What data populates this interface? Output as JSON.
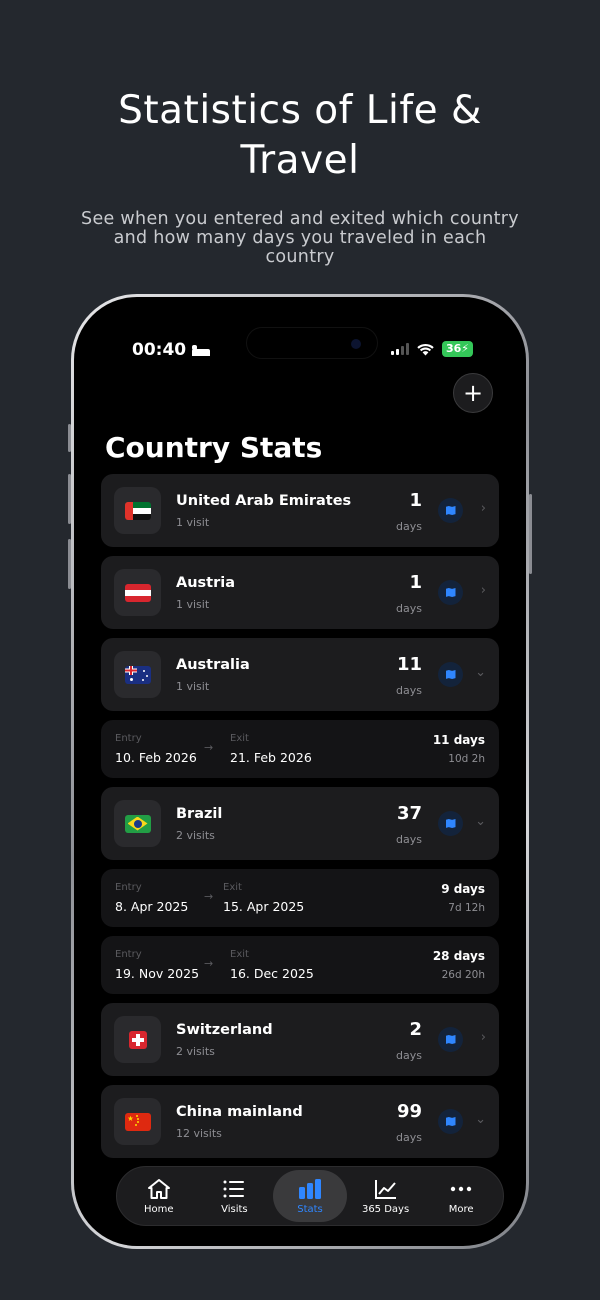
{
  "hero": {
    "title_line1": "Statistics of Life &",
    "title_line2": "Travel",
    "subtitle": "See when you entered and exited which country and how many days you traveled in each country"
  },
  "status_bar": {
    "time": "00:40",
    "battery": "36"
  },
  "header": {
    "add_label": "+",
    "title": "Country Stats"
  },
  "countries": [
    {
      "name": "United Arab Emirates",
      "visits": "1 visit",
      "days": "1",
      "days_label": "days",
      "flag": "uae-flag-icon"
    },
    {
      "name": "Austria",
      "visits": "1 visit",
      "days": "1",
      "days_label": "days",
      "flag": "austria-flag-icon"
    },
    {
      "name": "Australia",
      "visits": "1 visit",
      "days": "11",
      "days_label": "days",
      "flag": "australia-flag-icon"
    },
    {
      "name": "Brazil",
      "visits": "2 visits",
      "days": "37",
      "days_label": "days",
      "flag": "brazil-flag-icon"
    },
    {
      "name": "Switzerland",
      "visits": "2 visits",
      "days": "2",
      "days_label": "days",
      "flag": "switzerland-flag-icon"
    },
    {
      "name": "China mainland",
      "visits": "12 visits",
      "days": "99",
      "days_label": "days",
      "flag": "china-flag-icon"
    }
  ],
  "periods": [
    {
      "entry_label": "Entry",
      "entry": "10. Feb 2026",
      "exit_label": "Exit",
      "exit": "21. Feb 2026",
      "total": "11 days",
      "detail": "10d 2h"
    },
    {
      "entry_label": "Entry",
      "entry": "8. Apr 2025",
      "exit_label": "Exit",
      "exit": "15. Apr 2025",
      "total": "9 days",
      "detail": "7d 12h"
    },
    {
      "entry_label": "Entry",
      "entry": "19. Nov 2025",
      "exit_label": "Exit",
      "exit": "16. Dec 2025",
      "total": "28 days",
      "detail": "26d 20h"
    }
  ],
  "tabs": [
    {
      "label": "Home",
      "icon": "house-icon"
    },
    {
      "label": "Visits",
      "icon": "list-icon"
    },
    {
      "label": "Stats",
      "icon": "bar-chart-icon",
      "active": true
    },
    {
      "label": "365 Days",
      "icon": "trend-chart-icon"
    },
    {
      "label": "More",
      "icon": "ellipsis-icon"
    }
  ],
  "colors": {
    "accent": "#2f86ff",
    "background": "#24282e",
    "card": "#1c1c1e",
    "battery": "#34c759"
  }
}
